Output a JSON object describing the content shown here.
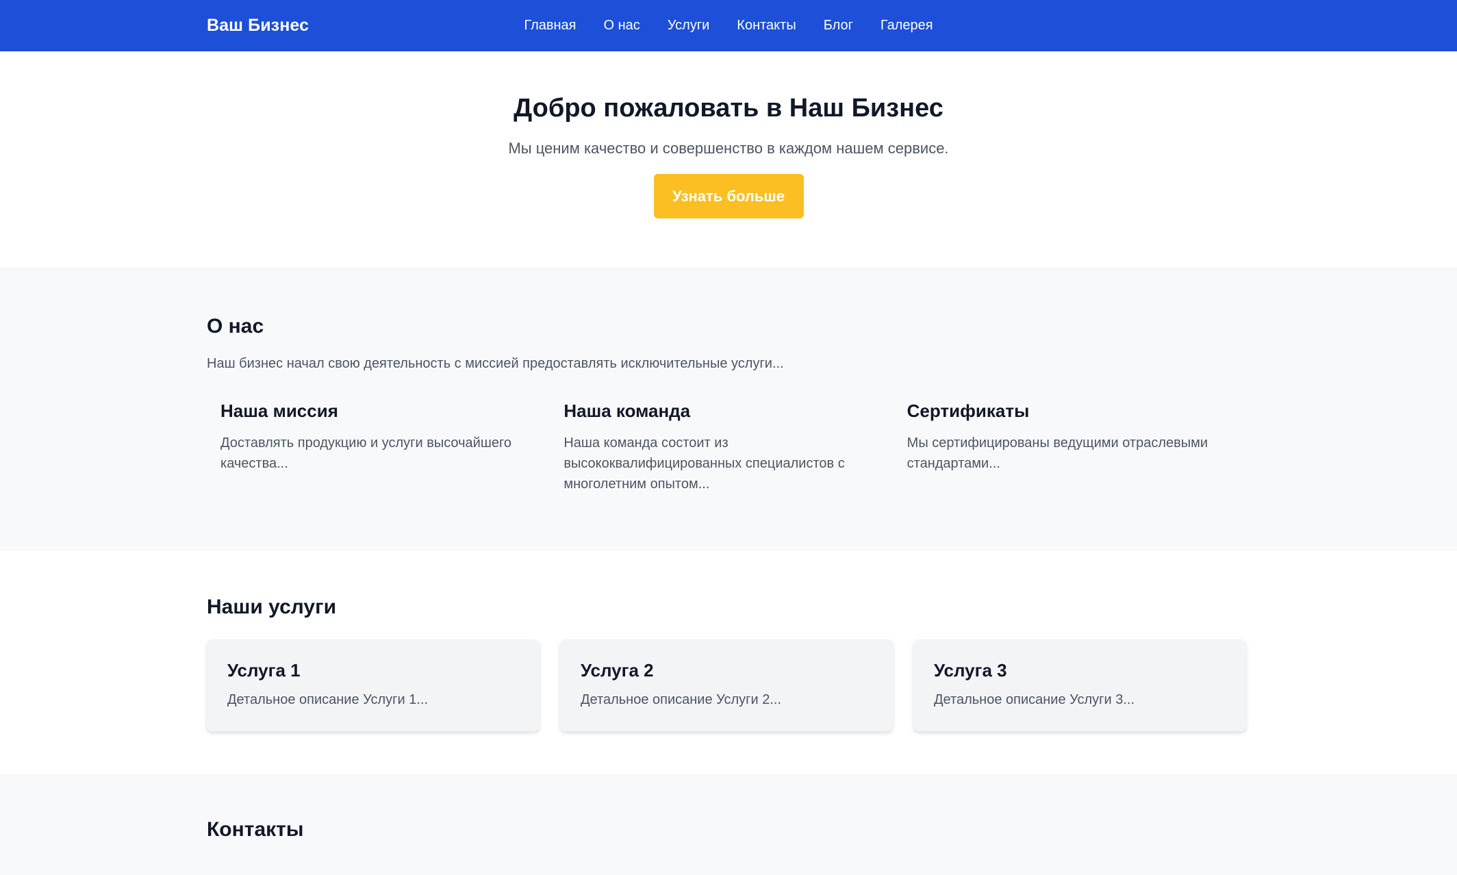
{
  "colors": {
    "header_bg": "#1d4fd8",
    "accent": "#fbbf24",
    "section_alt_bg": "#f8f9fb",
    "card_bg": "#f3f4f6"
  },
  "header": {
    "logo": "Ваш Бизнес",
    "nav": [
      {
        "label": "Главная"
      },
      {
        "label": "О нас"
      },
      {
        "label": "Услуги"
      },
      {
        "label": "Контакты"
      },
      {
        "label": "Блог"
      },
      {
        "label": "Галерея"
      }
    ]
  },
  "hero": {
    "title": "Добро пожаловать в Наш Бизнес",
    "subtitle": "Мы ценим качество и совершенство в каждом нашем сервисе.",
    "button_label": "Узнать больше"
  },
  "about": {
    "title": "О нас",
    "text": "Наш бизнес начал свою деятельность с миссией предоставлять исключительные услуги...",
    "columns": [
      {
        "title": "Наша миссия",
        "text": "Доставлять продукцию и услуги высочайшего качества..."
      },
      {
        "title": "Наша команда",
        "text": "Наша команда состоит из высококвалифицированных специалистов с многолетним опытом..."
      },
      {
        "title": "Сертификаты",
        "text": "Мы сертифицированы ведущими отраслевыми стандартами..."
      }
    ]
  },
  "services": {
    "title": "Наши услуги",
    "cards": [
      {
        "title": "Услуга 1",
        "text": "Детальное описание Услуги 1..."
      },
      {
        "title": "Услуга 2",
        "text": "Детальное описание Услуги 2..."
      },
      {
        "title": "Услуга 3",
        "text": "Детальное описание Услуги 3..."
      }
    ]
  },
  "contacts": {
    "title": "Контакты"
  }
}
